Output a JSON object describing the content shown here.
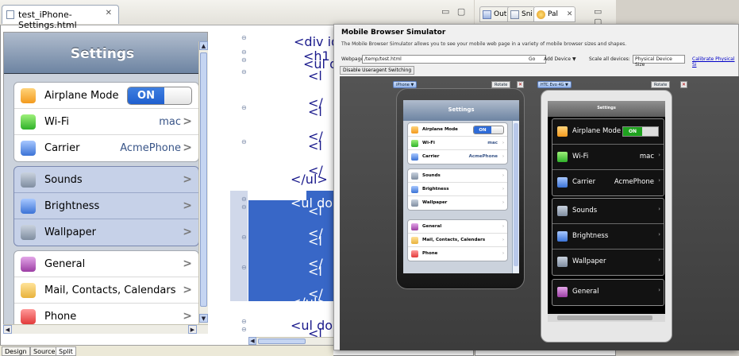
{
  "editor": {
    "tab_title": "test_iPhone-Settings.html",
    "tab_close": "✕",
    "window_controls": "▭ ▢"
  },
  "design": {
    "nav_title": "Settings",
    "groups": [
      {
        "selected": false,
        "rows": [
          {
            "label": "Airplane Mode",
            "toggle": "ON",
            "icon": "airplane-icon"
          },
          {
            "label": "Wi-Fi",
            "value": "mac",
            "icon": "wifi-icon"
          },
          {
            "label": "Carrier",
            "value": "AcmePhone",
            "icon": "carrier-icon"
          }
        ]
      },
      {
        "selected": true,
        "rows": [
          {
            "label": "Sounds",
            "icon": "sounds-icon"
          },
          {
            "label": "Brightness",
            "icon": "brightness-icon"
          },
          {
            "label": "Wallpaper",
            "icon": "wallpaper-icon"
          }
        ]
      },
      {
        "selected": false,
        "rows": [
          {
            "label": "General",
            "icon": "general-icon"
          },
          {
            "label": "Mail, Contacts, Calendars",
            "icon": "mail-icon"
          },
          {
            "label": "Phone",
            "icon": "phone-icon"
          }
        ]
      }
    ],
    "chevron": ">"
  },
  "source": {
    "lines": [
      "<div id=\"s",
      "<h1 do",
      "<ul do",
      "<l",
      "</",
      "<l",
      "</",
      "<l",
      "</",
      "</ul>",
      "<ul do",
      "<l",
      "</",
      "<l",
      "</",
      "<l",
      "</",
      "</ul>",
      "<ul do",
      "<l"
    ]
  },
  "bottom_tabs": [
    "Design",
    "Source",
    "Split"
  ],
  "right_panel": {
    "tabs": [
      "Outl",
      "Sni",
      "Pal"
    ],
    "tab_close": "✕"
  },
  "simulator": {
    "title": "Mobile Browser Simulator",
    "description": "The Mobile Browser Simulator allows you to see your mobile web page in a variety of mobile browser sizes and shapes.",
    "webpage_label": "Webpage:",
    "webpage_value": "/temp/test.html",
    "go_label": "Go",
    "add_device_label": "Add Device ▼",
    "scale_label": "Scale all devices:",
    "scale_value": "Physical Device Size",
    "calibrate_label": "Calibrate Physical Si",
    "disable_ua_label": "Disable Useragent Switching",
    "devices": [
      {
        "name": "iPhone ▼",
        "rotate": "Rotate"
      },
      {
        "name": "HTC Evo 4G ▼",
        "rotate": "Rotate"
      }
    ],
    "close_glyph": "✕"
  },
  "iphone_screen": {
    "title": "Settings",
    "groups": [
      [
        {
          "label": "Airplane Mode",
          "toggle": "ON",
          "icon": "airplane-icon"
        },
        {
          "label": "Wi-Fi",
          "value": "mac",
          "icon": "wifi-icon"
        },
        {
          "label": "Carrier",
          "value": "AcmePhone",
          "icon": "carrier-icon"
        }
      ],
      [
        {
          "label": "Sounds",
          "icon": "sounds-icon"
        },
        {
          "label": "Brightness",
          "icon": "brightness-icon"
        },
        {
          "label": "Wallpaper",
          "icon": "wallpaper-icon"
        }
      ],
      [
        {
          "label": "General",
          "icon": "general-icon"
        },
        {
          "label": "Mail, Contacts, Calendars",
          "icon": "mail-icon"
        },
        {
          "label": "Phone",
          "icon": "phone-icon"
        }
      ]
    ],
    "chevron": "›"
  },
  "htc_screen": {
    "title": "Settings",
    "groups": [
      [
        {
          "label": "Airplane Mode",
          "toggle": "ON",
          "icon": "airplane-icon"
        },
        {
          "label": "Wi-Fi",
          "value": "mac",
          "icon": "wifi-icon"
        },
        {
          "label": "Carrier",
          "value": "AcmePhone",
          "icon": "carrier-icon"
        }
      ],
      [
        {
          "label": "Sounds",
          "icon": "sounds-icon"
        },
        {
          "label": "Brightness",
          "icon": "brightness-icon"
        },
        {
          "label": "Wallpaper",
          "icon": "wallpaper-icon"
        }
      ],
      [
        {
          "label": "General",
          "icon": "general-icon"
        }
      ]
    ],
    "chevron": "›"
  },
  "colors": {
    "nav_bar": "#6d84a2",
    "selection": "#3867c7",
    "toggle_on_blue": "#2f6cd8",
    "toggle_on_green": "#1fa21f"
  }
}
